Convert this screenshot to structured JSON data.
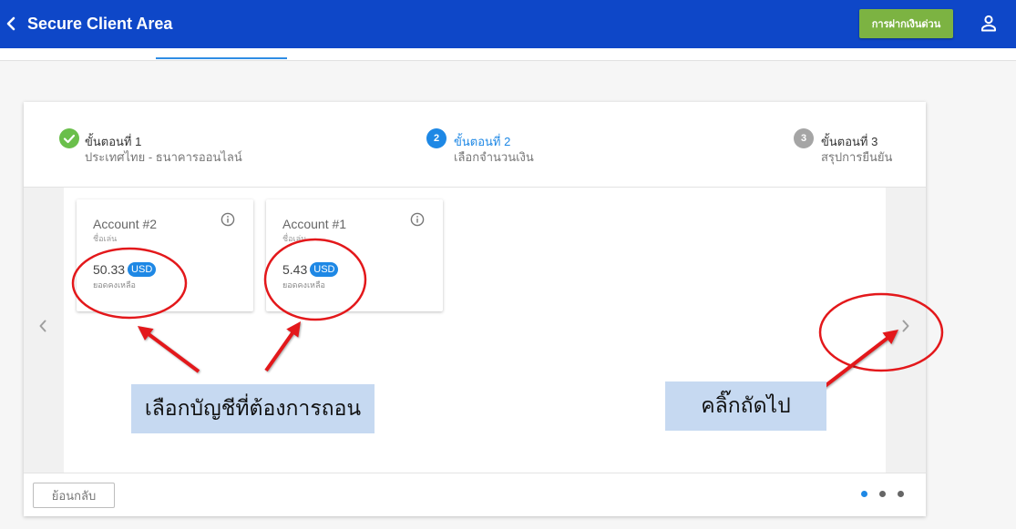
{
  "theme": {
    "header_bg": "#0e47c8",
    "green": "#7cb342",
    "blue": "#1e88e5",
    "step_done": "#6abf4b",
    "step_pending": "#a5a5a5",
    "red": "#e3181b",
    "label_bg": "#c6d9f1"
  },
  "header": {
    "back_icon": "chevron-left-icon",
    "title": "Secure Client Area",
    "quick_deposit_label": "การฝากเงินด่วน",
    "profile_icon": "person-outline-icon"
  },
  "stepper": {
    "active_step": 2,
    "steps": [
      {
        "icon": "check-icon",
        "title": "ขั้นตอนที่ 1",
        "subtitle": "ประเทศไทย - ธนาคารออนไลน์"
      },
      {
        "badge": "2",
        "title": "ขั้นตอนที่ 2",
        "subtitle": "เลือกจำนวนเงิน"
      },
      {
        "badge": "3",
        "title": "ขั้นตอนที่ 3",
        "subtitle": "สรุปการยืนยัน"
      }
    ]
  },
  "accounts": [
    {
      "name": "Account #2",
      "nickname_label": "ชื่อเล่น",
      "balance": "50.33",
      "currency": "USD",
      "balance_label": "ยอดคงเหลือ",
      "info_icon": "info-icon"
    },
    {
      "name": "Account #1",
      "nickname_label": "ชื่อเล่น",
      "balance": "5.43",
      "currency": "USD",
      "balance_label": "ยอดคงเหลือ",
      "info_icon": "info-icon"
    }
  ],
  "carousel": {
    "prev_icon": "chevron-left-icon",
    "next_icon": "chevron-right-icon",
    "page_count": 3,
    "current_page": 1
  },
  "footer": {
    "back_label": "ย้อนกลับ"
  },
  "annotations": {
    "select_account": "เลือกบัญชีที่ต้องการถอน",
    "click_next": "คลิ๊กถัดไป"
  }
}
